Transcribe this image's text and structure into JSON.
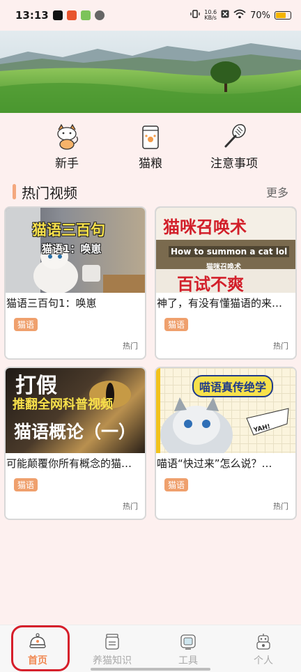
{
  "status_bar": {
    "time": "13:13",
    "net_speed_value": "10.6",
    "net_speed_unit": "KB/s",
    "battery": "70%"
  },
  "categories": [
    {
      "label": "新手",
      "icon": "cat-icon"
    },
    {
      "label": "猫粮",
      "icon": "cat-food-bag-icon"
    },
    {
      "label": "注意事项",
      "icon": "grooming-brush-icon"
    }
  ],
  "section": {
    "title": "热门视频",
    "more": "更多"
  },
  "videos": [
    {
      "thumb_lines": [
        "猫语三百句",
        "猫语1：唤崽"
      ],
      "title": "猫语三百句1：唤崽",
      "tag": "猫语",
      "footer": "热门"
    },
    {
      "thumb_lines": [
        "猫咪召唤术",
        "How to summon a cat lol",
        "猫咪召唤术",
        "百试不爽"
      ],
      "title": "神了，有没有懂猫语的来…",
      "tag": "猫语",
      "footer": "热门"
    },
    {
      "thumb_lines": [
        "打假",
        "推翻全网科普视频",
        "猫语概论（一）"
      ],
      "title": "可能颠覆你所有概念的猫…",
      "tag": "猫语",
      "footer": "热门"
    },
    {
      "thumb_lines": [
        "喵语真传绝学",
        "YAH!"
      ],
      "title": "喵语“快过来”怎么说？…",
      "tag": "猫语",
      "footer": "热门"
    }
  ],
  "bottom_nav": [
    {
      "label": "首页",
      "icon": "home-bell-icon",
      "active": true
    },
    {
      "label": "养猫知识",
      "icon": "food-jar-icon",
      "active": false
    },
    {
      "label": "工具",
      "icon": "tool-box-icon",
      "active": false
    },
    {
      "label": "个人",
      "icon": "robot-profile-icon",
      "active": false
    }
  ],
  "colors": {
    "background": "#fdf0ef",
    "accent": "#f4a87e",
    "tag": "#efa06d",
    "active_nav": "#f08a54",
    "highlight_outline": "#d61e2a"
  }
}
